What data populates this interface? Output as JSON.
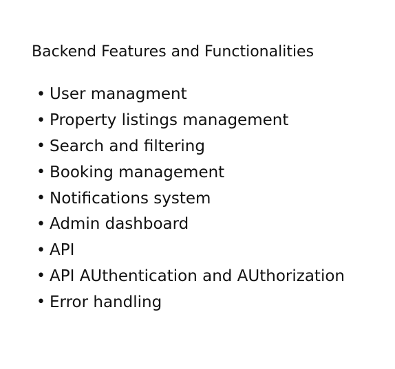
{
  "document": {
    "title": "Backend Features and Functionalities",
    "bullet_symbol": "•",
    "features": [
      "User managment",
      "Property listings management",
      "Search and filtering",
      "Booking management",
      "Notifications system",
      "Admin dashboard",
      "API",
      "API AUthentication and AUthorization",
      "Error handling"
    ]
  }
}
